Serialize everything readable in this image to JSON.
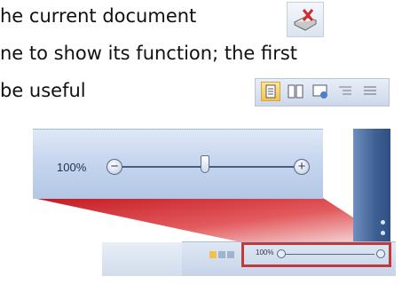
{
  "text": {
    "line1": "he current document",
    "line2": "ne to show its function; the first",
    "line3": "be useful"
  },
  "icons": {
    "proofing": "proofing-book-check-icon",
    "views": [
      "print-layout-icon",
      "full-screen-reading-icon",
      "web-layout-icon",
      "outline-icon",
      "draft-icon"
    ]
  },
  "zoom": {
    "label": "100%",
    "minus_glyph": "−",
    "plus_glyph": "+",
    "level_percent": 100
  },
  "status_bar": {
    "zoom_label": "100%"
  },
  "colors": {
    "highlight_border": "#c0393b",
    "callout_red": "#d21f26",
    "active_view": "#f5c34f"
  }
}
